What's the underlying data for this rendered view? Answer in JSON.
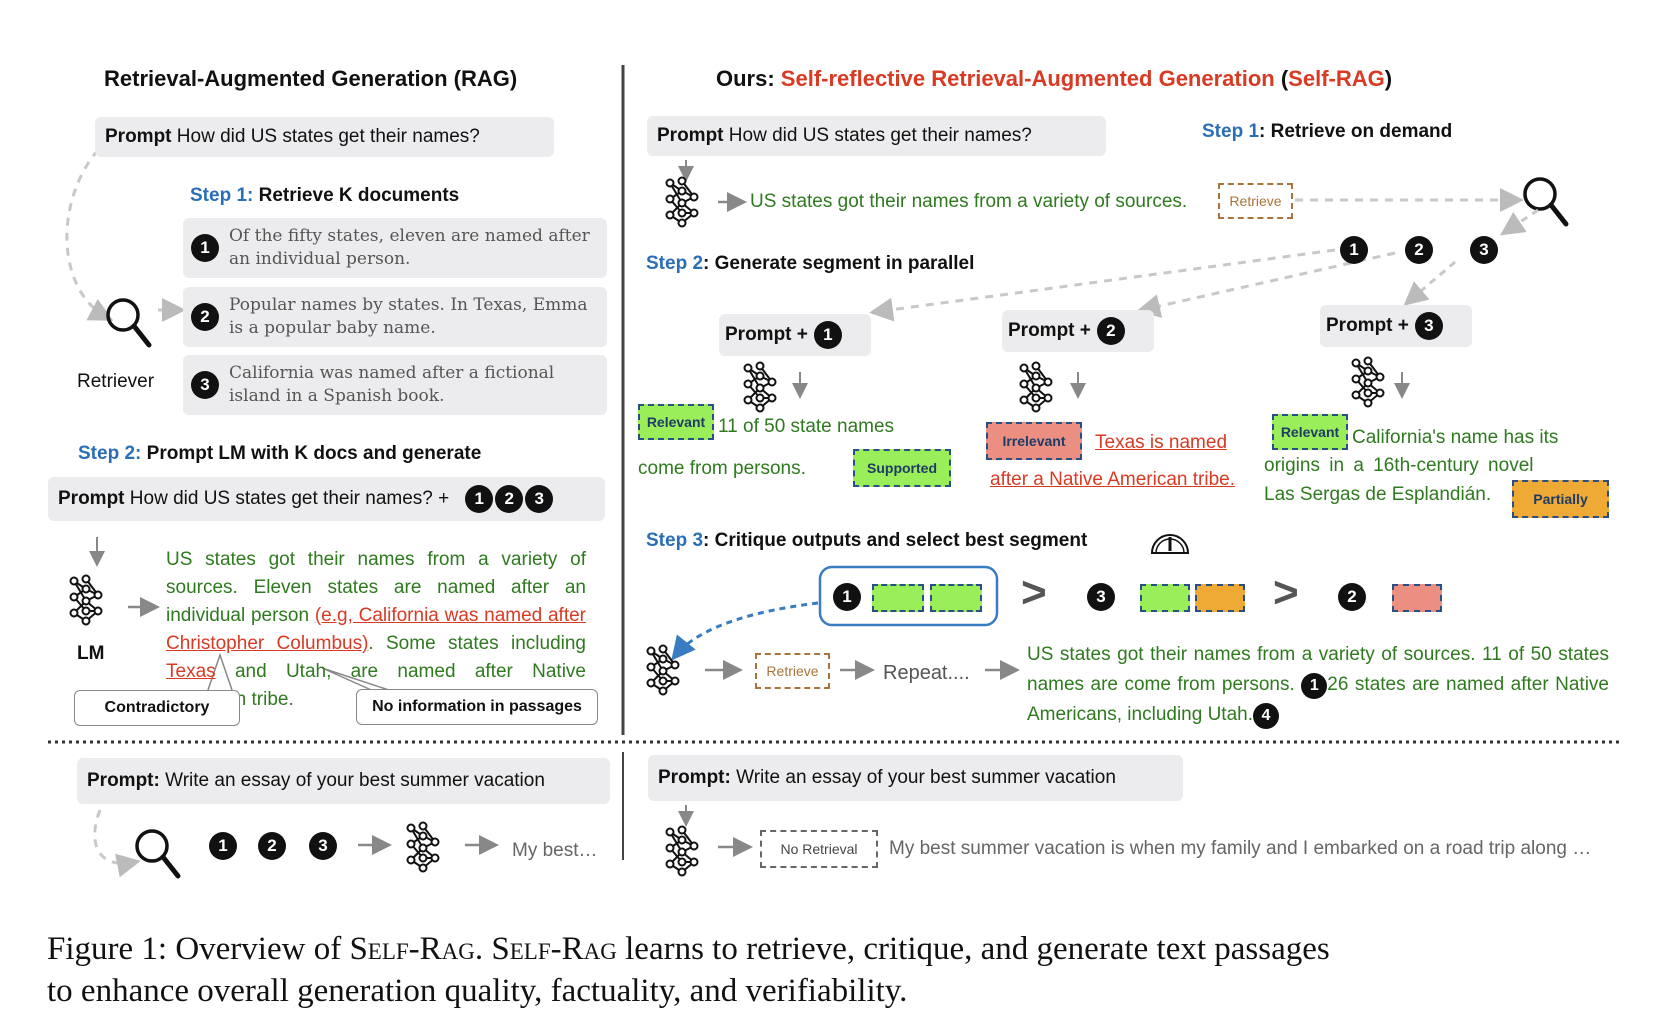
{
  "left_panel": {
    "title": "Retrieval-Augmented Generation (RAG)",
    "prompt_label": "Prompt",
    "prompt_text": "How did US states get their names?",
    "step1_prefix": "Step 1:",
    "step1_text": "Retrieve K documents",
    "retriever_label": "Retriever",
    "documents": [
      {
        "num": "1",
        "text": "Of the fifty states, eleven are named after an individual person."
      },
      {
        "num": "2",
        "text": "Popular names by states. In Texas, Emma is a popular baby name."
      },
      {
        "num": "3",
        "text": "California was named after a fictional island in a Spanish book."
      }
    ],
    "step2_prefix": "Step 2:",
    "step2_text": "Prompt LM with K docs and generate",
    "prompt2_text": "How did US states get their names? +",
    "prompt2_nums": [
      "1",
      "2",
      "3"
    ],
    "lm_label": "LM",
    "output_parts": {
      "p1": "US states got their names from a variety of sources. Eleven states are named after an individual person ",
      "p2": "(e.g, California was named after Christopher Columbus)",
      "p3": ". Some states including ",
      "p4": "Texas",
      "p5": " and Utah, are named after Native American tribe."
    },
    "callout_contradictory": "Contradictory",
    "callout_noinfo": "No information in passages"
  },
  "right_panel": {
    "title_prefix": "Ours: ",
    "title_main": "Self-reflective Retrieval-Augmented Generation",
    "title_paren_open": " (",
    "title_short": "Self-RAG",
    "title_paren_close": ")",
    "prompt_label": "Prompt",
    "prompt_text": "How did US states get their names?",
    "step1_prefix": "Step 1",
    "step1_text": ": Retrieve on demand",
    "first_output": "US states got their names from a variety of sources.",
    "retrieve_token": "Retrieve",
    "retrieved_nums": [
      "1",
      "2",
      "3"
    ],
    "step2_prefix": "Step 2",
    "step2_text": ": Generate segment in parallel",
    "segments": [
      {
        "prompt": "Prompt +",
        "num": "1",
        "relevance": "Relevant",
        "text_a": "11 of 50 state names",
        "text_b": "come from persons.",
        "support": "Supported"
      },
      {
        "prompt": "Prompt +",
        "num": "2",
        "relevance": "Irrelevant",
        "text_a": "Texas is named",
        "text_b": "after a Native American tribe."
      },
      {
        "prompt": "Prompt +",
        "num": "3",
        "relevance": "Relevant",
        "text_a": "California's name has its",
        "text_b": "origins in a 16th-century novel",
        "text_c": "Las Sergas de Esplandián.",
        "support": "Partially"
      }
    ],
    "step3_prefix": "Step 3",
    "step3_text": ": Critique outputs and select best segment",
    "ranking": [
      {
        "num": "1",
        "tags": [
          "relevant",
          "supported"
        ]
      },
      {
        "num": "3",
        "tags": [
          "relevant",
          "partially"
        ]
      },
      {
        "num": "2",
        "tags": [
          "irrelevant"
        ]
      }
    ],
    "ranking_op": ">",
    "repeat_label": "Repeat....",
    "final_output_a": "US states got their names from a variety of sources. 11 of 50 states names are come from persons.",
    "final_num_a": "1",
    "final_output_b": "26 states are named after Native Americans, including Utah.",
    "final_num_b": "4"
  },
  "bottom_left": {
    "prompt_label": "Prompt:",
    "prompt_text": "Write an essay of your best summer vacation",
    "nums": [
      "1",
      "2",
      "3"
    ],
    "output": "My best…"
  },
  "bottom_right": {
    "prompt_label": "Prompt:",
    "prompt_text": "Write an essay of your best summer vacation",
    "no_retrieval_token": "No Retrieval",
    "output": "My best summer vacation is when my family and I embarked on a road trip along …"
  },
  "caption": {
    "prefix": "Figure 1: Overview of ",
    "name1": "Self-Rag",
    "mid": ". ",
    "name2": "Self-Rag",
    "rest1": " learns to retrieve, critique, and generate text passages",
    "line2": "to enhance overall generation quality, factuality, and verifiability."
  },
  "colors": {
    "accent_red": "#d93a24",
    "step_blue": "#2a6fb5",
    "output_green": "#2f7a1f",
    "relevant_green": "#99ee5a",
    "irrelevant_red": "#ea8f82",
    "partially_orange": "#efaa35",
    "retrieve_brown": "#a8743a"
  }
}
